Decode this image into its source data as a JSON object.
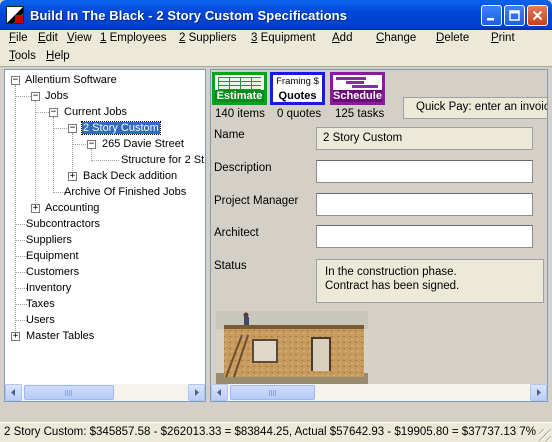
{
  "window": {
    "title": "Build In The Black - 2 Story Custom  Specifications"
  },
  "menu_row1": [
    {
      "label": "File",
      "underline": "F",
      "rest": "ile"
    },
    {
      "label": "Edit",
      "underline": "E",
      "rest": "dit"
    },
    {
      "label": "View",
      "underline": "V",
      "rest": "iew"
    },
    {
      "label": "1 Employees",
      "underline": "1",
      "rest": " Employees"
    },
    {
      "label": "2 Suppliers",
      "underline": "2",
      "rest": " Suppliers"
    },
    {
      "label": "3 Equipment",
      "underline": "3",
      "rest": " Equipment"
    },
    {
      "label": "Add",
      "underline": "A",
      "rest": "dd"
    },
    {
      "label": "Change",
      "underline": "C",
      "rest": "hange"
    },
    {
      "label": "Delete",
      "underline": "D",
      "rest": "elete"
    },
    {
      "label": "Print",
      "underline": "P",
      "rest": "rint"
    }
  ],
  "menu_row2": [
    {
      "label": "Tools",
      "underline": "T",
      "rest": "ools"
    },
    {
      "label": "Help",
      "underline": "H",
      "rest": "elp"
    }
  ],
  "tree": {
    "root": "Allentium Software",
    "jobs": "Jobs",
    "current_jobs": "Current Jobs",
    "selected_job": "2 Story Custom",
    "address": "265 Davie Street",
    "structure": "Structure for 2 St",
    "back_deck": "Back Deck addition",
    "archive": "Archive Of Finished Jobs",
    "accounting": "Accounting",
    "subcontractors": "Subcontractors",
    "suppliers": "Suppliers",
    "equipment": "Equipment",
    "customers": "Customers",
    "inventory": "Inventory",
    "taxes": "Taxes",
    "users": "Users",
    "master_tables": "Master Tables"
  },
  "tabs": {
    "estimate": "Estimate",
    "quotes_top": "Framing $",
    "quotes": "Quotes",
    "schedule": "Schedule"
  },
  "stats": {
    "items": "140 items",
    "quotes": "0 quotes",
    "tasks": "125 tasks"
  },
  "quick_pay": "Quick Pay: enter an invoice",
  "fields": {
    "name_label": "Name",
    "name_value": "2 Story Custom",
    "description_label": "Description",
    "description_value": "",
    "pm_label": "Project Manager",
    "pm_value": "",
    "architect_label": "Architect",
    "architect_value": "",
    "status_label": "Status",
    "status_line1": "In the construction phase.",
    "status_line2": "Contract has been signed."
  },
  "statusbar": "2 Story Custom: $345857.58 - $262013.33 = $83844.25, Actual $57642.93 - $19905.80 = $37737.13  7%"
}
